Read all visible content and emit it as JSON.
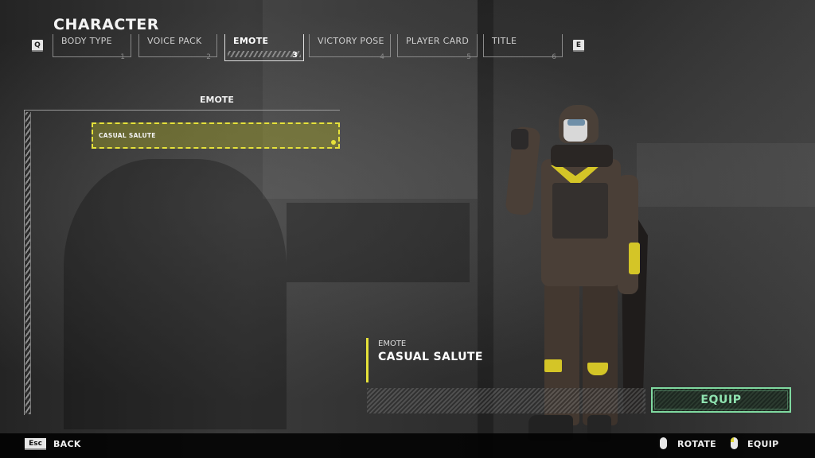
{
  "header": {
    "title": "CHARACTER",
    "prev_key": "Q",
    "next_key": "E"
  },
  "tabs": [
    {
      "label": "BODY TYPE",
      "number": "1",
      "active": false
    },
    {
      "label": "VOICE PACK",
      "number": "2",
      "active": false
    },
    {
      "label": "EMOTE",
      "number": "3",
      "active": true
    },
    {
      "label": "VICTORY POSE",
      "number": "4",
      "active": false
    },
    {
      "label": "PLAYER CARD",
      "number": "5",
      "active": false
    },
    {
      "label": "TITLE",
      "number": "6",
      "active": false
    }
  ],
  "list": {
    "title": "EMOTE",
    "items": [
      {
        "label": "CASUAL SALUTE",
        "selected": true,
        "equipped": true
      }
    ]
  },
  "detail": {
    "category": "EMOTE",
    "name": "CASUAL SALUTE",
    "equip_label": "EQUIP"
  },
  "footer": {
    "back_key": "Esc",
    "back_label": "BACK",
    "rotate_label": "ROTATE",
    "equip_label": "EQUIP"
  },
  "colors": {
    "accent_yellow": "#e6e23a",
    "equip_green": "#8fe3b0"
  }
}
